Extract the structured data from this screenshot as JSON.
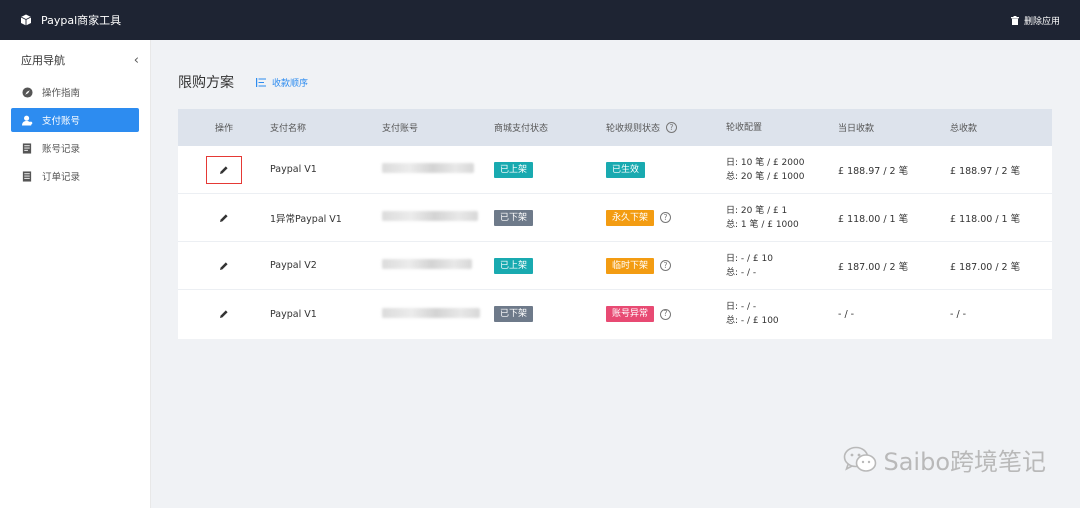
{
  "app": {
    "title": "Paypal商家工具",
    "uninstall_label": "删除应用"
  },
  "sidebar": {
    "header": "应用导航",
    "collapse_glyph": "‹",
    "items": [
      {
        "label": "操作指南",
        "icon": "compass-icon",
        "active": false
      },
      {
        "label": "支付账号",
        "icon": "user-icon",
        "active": true
      },
      {
        "label": "账号记录",
        "icon": "ledger-icon",
        "active": false
      },
      {
        "label": "订单记录",
        "icon": "order-list-icon",
        "active": false
      }
    ]
  },
  "main": {
    "title": "限购方案",
    "sort_label": "收款顺序"
  },
  "table": {
    "headers": [
      "操作",
      "支付名称",
      "支付账号",
      "商城支付状态",
      "轮收规则状态",
      "轮收配置",
      "当日收款",
      "总收款"
    ],
    "help_glyph": "?",
    "rows": [
      {
        "name": "Paypal V1",
        "shop_status": "已上架",
        "rule_status": "已生效",
        "config_day": "日: 10 笔 / £ 2000",
        "config_total": "总: 20 笔 / £ 1000",
        "today": "£ 188.97 / 2 笔",
        "total": "£ 188.97 / 2 笔"
      },
      {
        "name": "1异常Paypal V1",
        "shop_status": "已下架",
        "rule_status": "永久下架",
        "config_day": "日: 20 笔 / £ 1",
        "config_total": "总: 1 笔 / £ 1000",
        "today": "£ 118.00 / 1 笔",
        "total": "£ 118.00 / 1 笔"
      },
      {
        "name": "Paypal V2",
        "shop_status": "已上架",
        "rule_status": "临时下架",
        "config_day": "日: - / £ 10",
        "config_total": "总: - / -",
        "today": "£ 187.00 / 2 笔",
        "total": "£ 187.00 / 2 笔"
      },
      {
        "name": "Paypal V1",
        "shop_status": "已下架",
        "rule_status": "账号异常",
        "config_day": "日: - / -",
        "config_total": "总: - / £ 100",
        "today": "- / -",
        "total": "- / -"
      }
    ]
  },
  "colors": {
    "topbar": "#1e2433",
    "accent": "#2d8cf0",
    "tag_teal": "#19aab0",
    "tag_gray": "#6e7a8a",
    "tag_orange": "#f39c12",
    "tag_pink": "#e84a73",
    "highlight": "#e53935"
  },
  "watermark": {
    "text": "Saibo跨境笔记",
    "icon": "wechat-icon"
  }
}
